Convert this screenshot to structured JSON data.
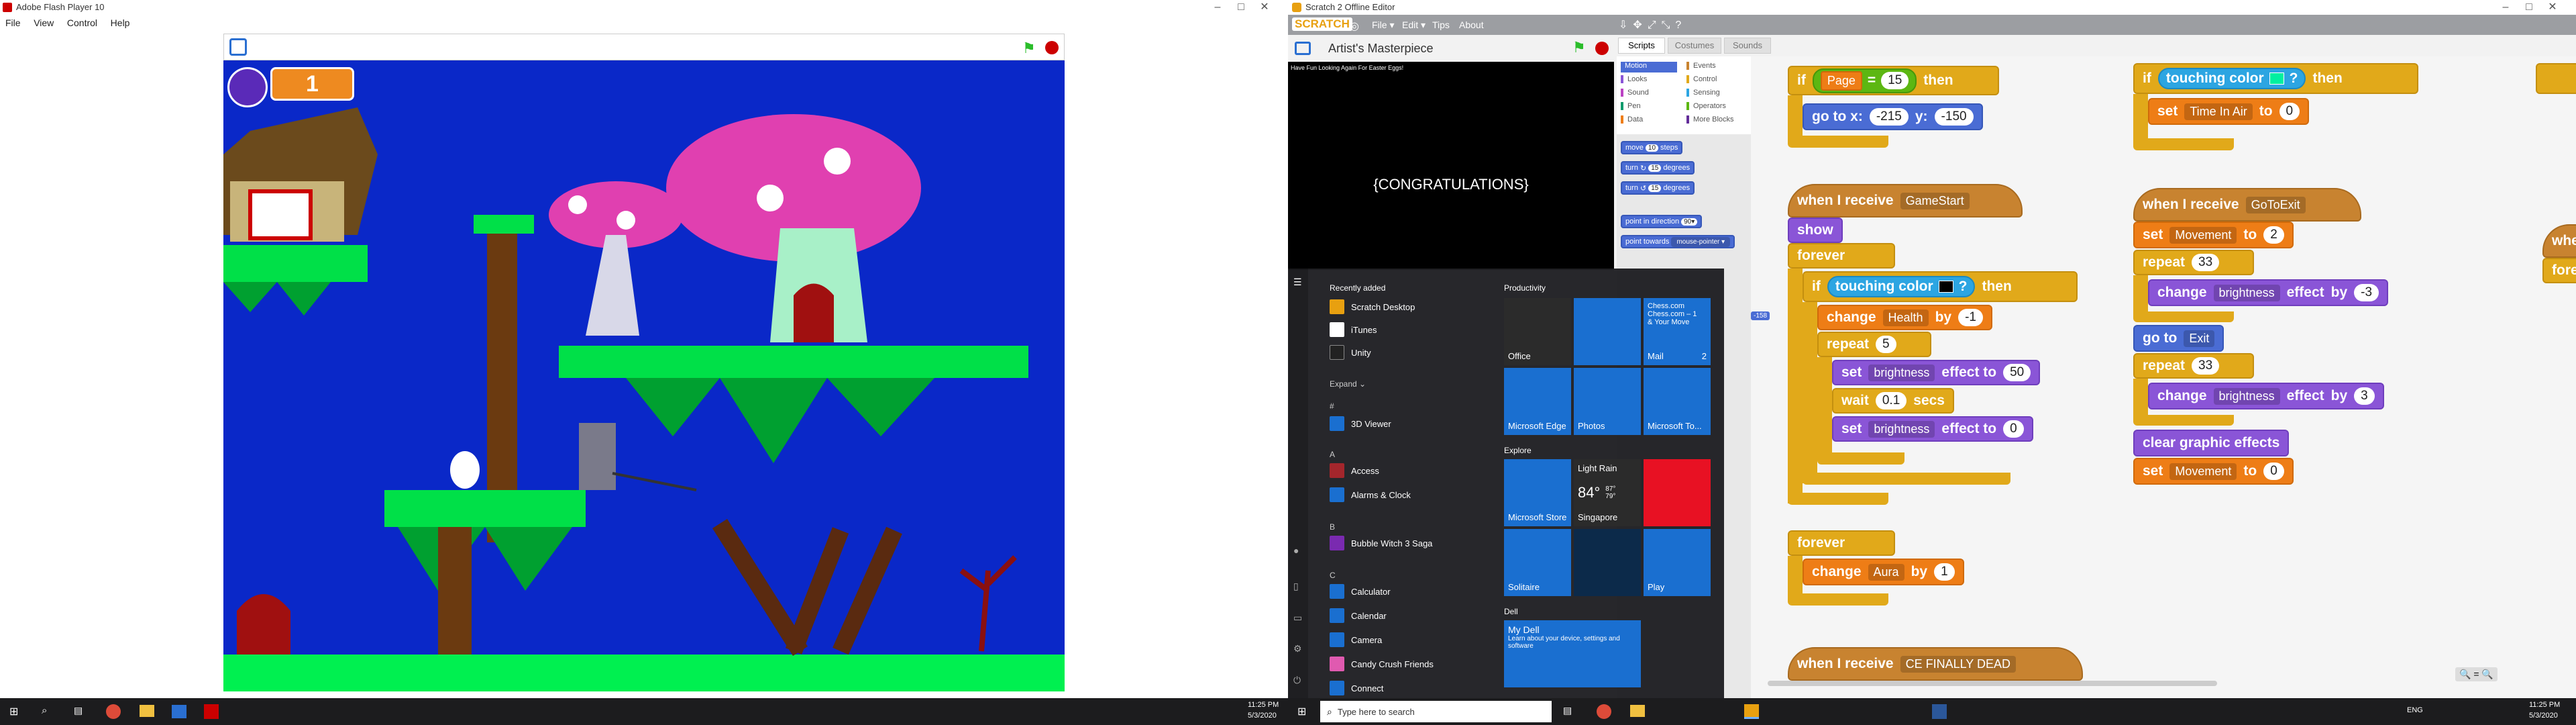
{
  "flash": {
    "title": "Adobe Flash Player 10",
    "menu": [
      "File",
      "View",
      "Control",
      "Help"
    ],
    "game": {
      "lives": "1"
    }
  },
  "scratch": {
    "title": "Scratch 2 Offline Editor",
    "logo": "SCRATCH",
    "menu": [
      "File ▾",
      "Edit ▾",
      "Tips",
      "About"
    ],
    "project_name": "Artist's Masterpiece",
    "stage_small_text": "Have Fun Looking Again For Easter Eggs!",
    "stage_big_text": "{CONGRATULATIONS}",
    "tabs": [
      "Scripts",
      "Costumes",
      "Sounds"
    ],
    "categories_left": [
      "Motion",
      "Looks",
      "Sound",
      "Pen",
      "Data"
    ],
    "categories_right": [
      "Events",
      "Control",
      "Sensing",
      "Operators",
      "More Blocks"
    ],
    "palette": {
      "move": "move",
      "move_val": "10",
      "steps": "steps",
      "turn1": "turn",
      "turn1_val": "15",
      "degrees1": "degrees",
      "turn2": "turn",
      "turn2_val": "15",
      "degrees2": "degrees",
      "point_dir": "point in direction",
      "point_dir_val": "90▾",
      "point_towards": "point towards",
      "point_towards_val": "mouse-pointer ▾"
    },
    "scripts": {
      "s1_if": "if",
      "s1_var": "Page",
      "s1_eq": "=",
      "s1_val": "15",
      "s1_then": "then",
      "s1_goto": "go to x:",
      "s1_x": "-215",
      "s1_y_label": "y:",
      "s1_y": "-150",
      "s2_hat": "when I receive",
      "s2_msg": "GameStart",
      "s2_show": "show",
      "s2_forever": "forever",
      "s2_if": "if",
      "s2_touch": "touching color",
      "s2_q": "?",
      "s2_then": "then",
      "s2_change": "change",
      "s2_health": "Health",
      "s2_by": "by",
      "s2_by_val": "-1",
      "s2_repeat": "repeat",
      "s2_repeat_val": "5",
      "s2_set1": "set",
      "s2_eff1": "brightness",
      "s2_to1": "effect to",
      "s2_val1": "50",
      "s2_wait": "wait",
      "s2_wait_val": "0.1",
      "s2_secs": "secs",
      "s2_set2": "set",
      "s2_eff2": "brightness",
      "s2_to2": "effect to",
      "s2_val2": "0",
      "s3_forever": "forever",
      "s3_change": "change",
      "s3_var": "Aura",
      "s3_by": "by",
      "s3_val": "1",
      "s4_hat": "when I receive",
      "s4_msg": "CE FINALLY DEAD",
      "s5_if": "if",
      "s5_touch": "touching color",
      "s5_q": "?",
      "s5_then": "then",
      "s5_set": "set",
      "s5_var": "Time In Air",
      "s5_to": "to",
      "s5_val": "0",
      "s6_hat": "when I receive",
      "s6_msg": "GoToExit",
      "s6_set": "set",
      "s6_var": "Movement",
      "s6_to": "to",
      "s6_val": "2",
      "s6_repeat": "repeat",
      "s6_repeat_val": "33",
      "s6_change": "change",
      "s6_eff": "brightness",
      "s6_effect": "effect",
      "s6_by": "by",
      "s6_by_val": "-3",
      "s6_goto": "go to",
      "s6_goto_val": "Exit",
      "s6_repeat2": "repeat",
      "s6_repeat2_val": "33",
      "s6_change2": "change",
      "s6_eff2": "brightness",
      "s6_effect2": "effect",
      "s6_by2": "by",
      "s6_by2_val": "3",
      "s6_clear": "clear graphic effects",
      "s6_set2": "set",
      "s6_var2": "Movement",
      "s6_to2": "to",
      "s6_val2": "0",
      "s7_when": "when",
      "s7_forever": "foreve"
    },
    "hint_tag": "-158"
  },
  "start_menu": {
    "recently_added": "Recently added",
    "recent": [
      "Scratch Desktop",
      "iTunes",
      "Unity"
    ],
    "expand": "Expand ⌄",
    "letters": [
      "#",
      "A",
      "B",
      "C"
    ],
    "apps": [
      "3D Viewer",
      "Access",
      "Alarms & Clock",
      "Bubble Witch 3 Saga",
      "Calculator",
      "Calendar",
      "Camera",
      "Candy Crush Friends",
      "Connect"
    ],
    "productivity": "Productivity",
    "explore": "Explore",
    "dell": "Dell",
    "tiles": {
      "office": "Office",
      "mail": "Mail",
      "mail_line1": "Chess.com",
      "mail_line2": "Chess.com – 1",
      "mail_line3": "& Your Move",
      "mail_count": "2",
      "edge": "Microsoft Edge",
      "photos": "Photos",
      "todo": "Microsoft To...",
      "store": "Microsoft Store",
      "weather": "Light Rain",
      "temp": "84°",
      "temp_hi": "87°",
      "temp_lo": "79°",
      "city": "Singapore",
      "solitaire": "Solitaire",
      "play": "Play",
      "mydell": "My Dell",
      "mydell_sub": "Learn about your device, settings and software"
    }
  },
  "taskbar": {
    "search_placeholder": "Type here to search",
    "time1": "11:25 PM",
    "date1": "5/3/2020",
    "time2": "11:25 PM",
    "date2": "5/3/2020",
    "lang": "ENG"
  },
  "colors": {
    "stage_bg": "#0a28c8",
    "grass": "#00f050",
    "scratch_orange": "#e1a91a"
  }
}
